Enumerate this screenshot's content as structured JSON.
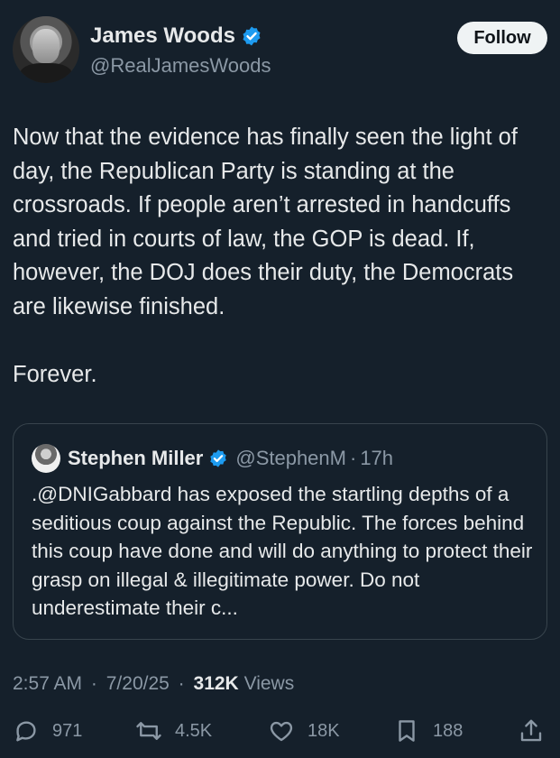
{
  "author": {
    "name": "James Woods",
    "handle": "@RealJamesWoods",
    "follow_label": "Follow",
    "verified_color": "#1d9bf0"
  },
  "tweet": {
    "text": "Now that the evidence has finally seen the light of day, the Republican Party is standing at the crossroads. If people aren’t arrested in handcuffs and tried in courts of law, the GOP is dead. If, however, the DOJ does their duty, the Democrats are likewise finished.\n\nForever."
  },
  "quote": {
    "name": "Stephen Miller",
    "handle": "@StephenM",
    "separator": "·",
    "age": "17h",
    "text": ".@DNIGabbard has exposed the startling depths of a seditious coup against the Republic. The forces behind this coup have done and will do anything to protect their grasp on illegal & illegitimate power. Do not underestimate their c..."
  },
  "meta": {
    "time": "2:57 AM",
    "sep1": "·",
    "date": "7/20/25",
    "sep2": "·",
    "views_count": "312K",
    "views_label": "Views"
  },
  "actions": {
    "replies": "971",
    "reposts": "4.5K",
    "likes": "18K",
    "bookmarks": "188"
  },
  "icons": {
    "reply": "reply-icon",
    "repost": "repost-icon",
    "like": "heart-icon",
    "bookmark": "bookmark-icon",
    "share": "share-icon",
    "verified": "verified-badge-icon"
  }
}
